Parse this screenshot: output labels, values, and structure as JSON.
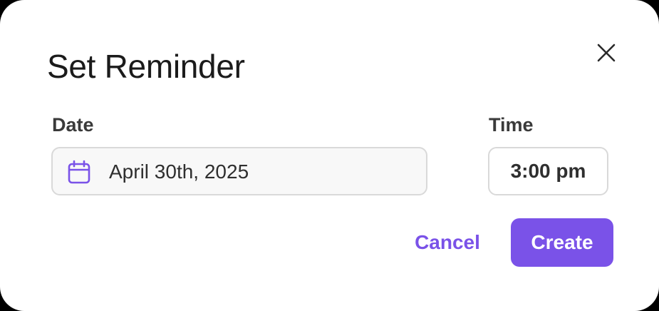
{
  "dialog": {
    "title": "Set Reminder",
    "close_icon": "close-icon"
  },
  "date": {
    "label": "Date",
    "value": "April 30th, 2025",
    "icon": "calendar-icon"
  },
  "time": {
    "label": "Time",
    "value": "3:00 pm"
  },
  "actions": {
    "cancel_label": "Cancel",
    "create_label": "Create"
  },
  "colors": {
    "accent": "#7a52e8",
    "field_border": "#d9d9d9",
    "title_text": "#1b1b1b"
  }
}
